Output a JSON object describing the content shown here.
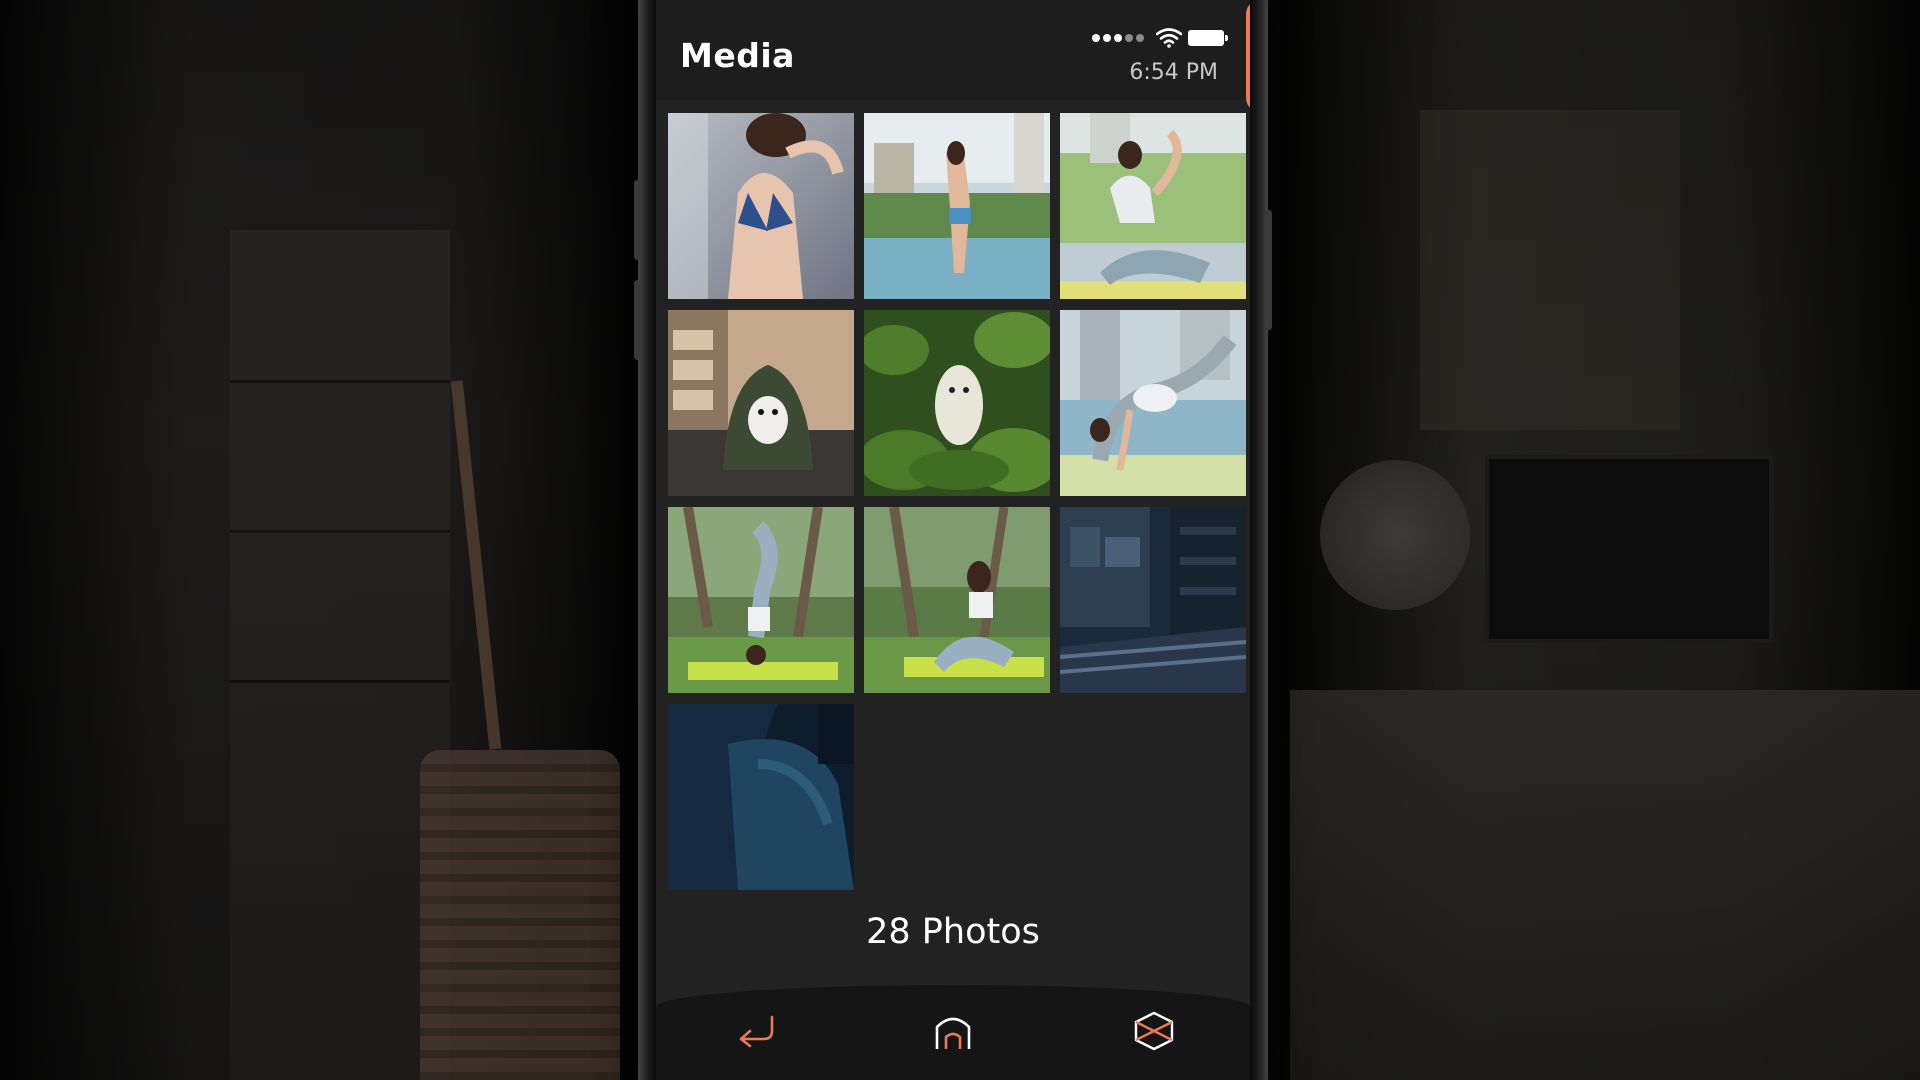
{
  "header": {
    "title": "Media",
    "time": "6:54 PM"
  },
  "status": {
    "signal_bars": 5,
    "signal_strength": 3,
    "battery_level": 1.0
  },
  "gallery": {
    "items": [
      {
        "label": "photo-1"
      },
      {
        "label": "photo-2"
      },
      {
        "label": "photo-3"
      },
      {
        "label": "photo-4"
      },
      {
        "label": "photo-5"
      },
      {
        "label": "photo-6"
      },
      {
        "label": "photo-7"
      },
      {
        "label": "photo-8"
      },
      {
        "label": "photo-9"
      },
      {
        "label": "photo-10"
      }
    ],
    "count_label": "28 Photos"
  },
  "navbar": {
    "items": [
      {
        "icon": "back-arrow-icon"
      },
      {
        "icon": "home-icon"
      },
      {
        "icon": "cube-icon"
      }
    ],
    "accent_color": "#ec7a52"
  }
}
